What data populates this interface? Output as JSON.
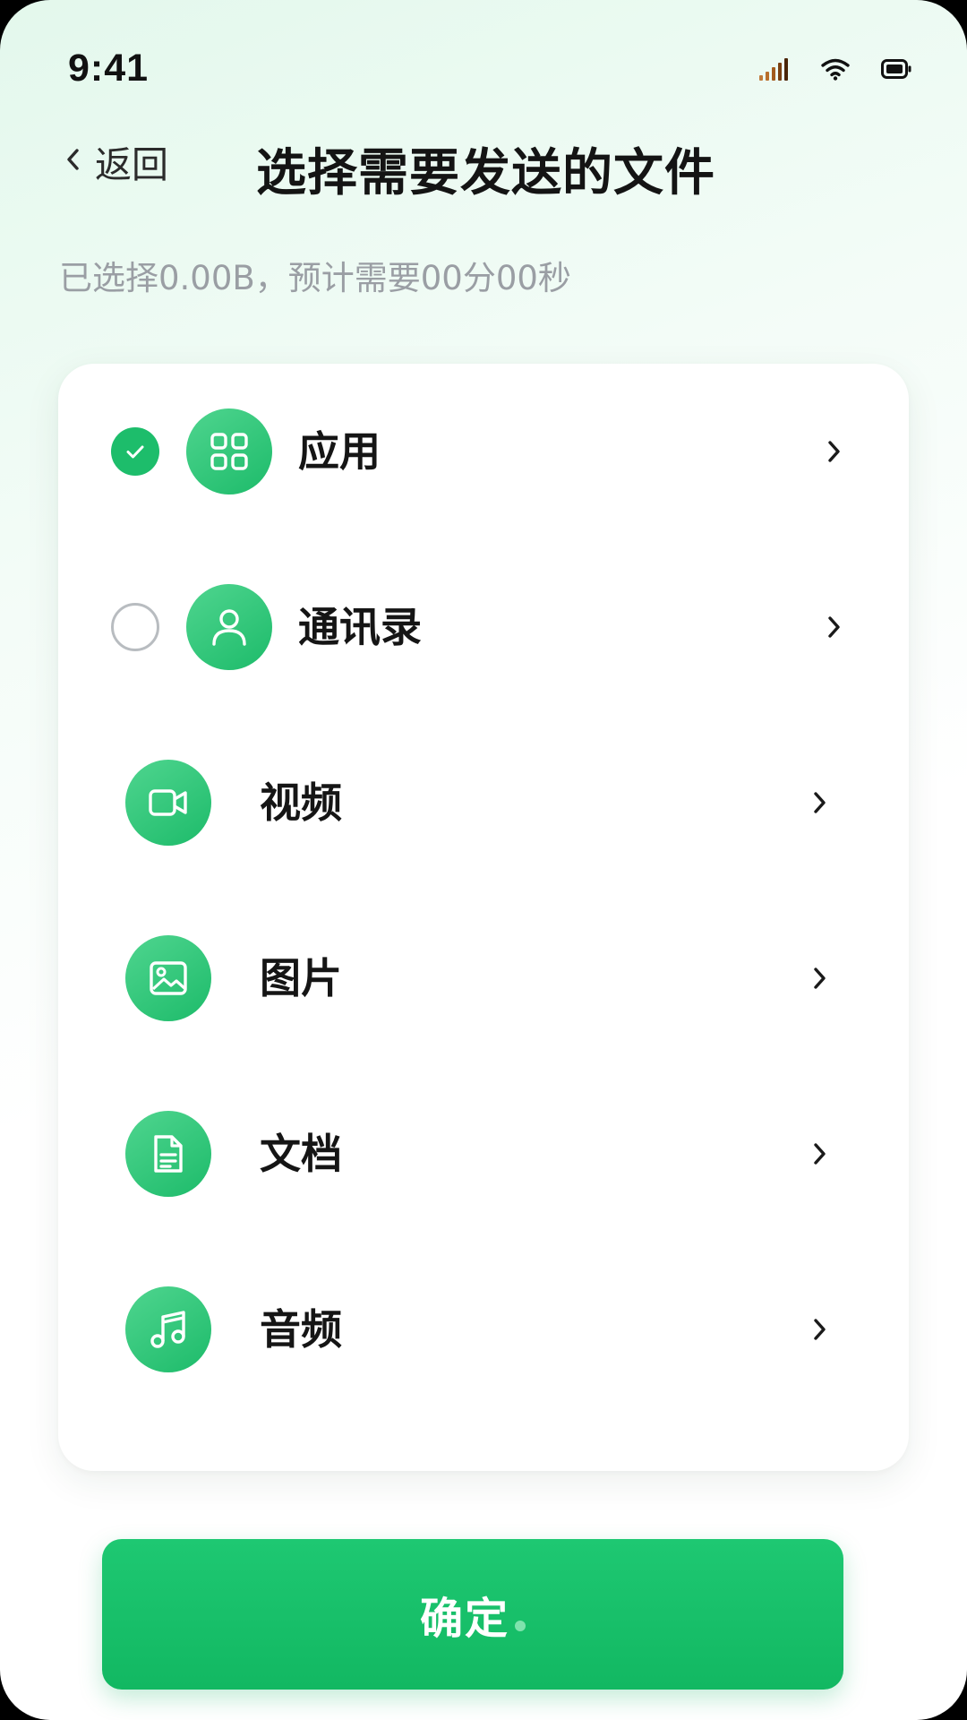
{
  "status_bar": {
    "time": "9:41"
  },
  "nav": {
    "back_label": "返回",
    "title": "选择需要发送的文件"
  },
  "summary": "已选择0.00B，预计需要00分00秒",
  "categories": [
    {
      "label": "应用",
      "icon": "apps-grid-icon",
      "selectable": true,
      "checked": true
    },
    {
      "label": "通讯录",
      "icon": "person-icon",
      "selectable": true,
      "checked": false
    },
    {
      "label": "视频",
      "icon": "video-camera-icon",
      "selectable": false
    },
    {
      "label": "图片",
      "icon": "image-icon",
      "selectable": false
    },
    {
      "label": "文档",
      "icon": "document-icon",
      "selectable": false
    },
    {
      "label": "音频",
      "icon": "music-note-icon",
      "selectable": false
    }
  ],
  "confirm_label": "确定",
  "colors": {
    "accent": "#1dbd6b",
    "title": "#141414",
    "muted": "#9a9ea4"
  }
}
